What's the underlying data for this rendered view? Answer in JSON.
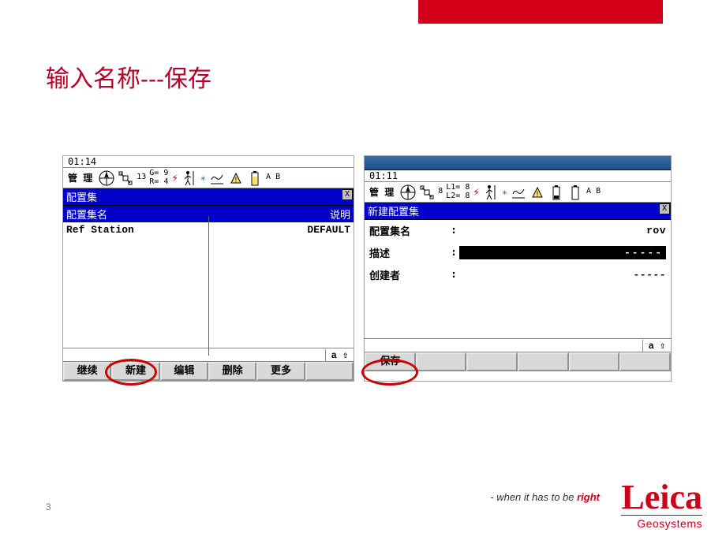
{
  "slide": {
    "title": "输入名称---保存",
    "page": "3",
    "tagline_pre": "- when it has to be ",
    "tagline_em": "right",
    "logo_brand": "Leica",
    "logo_sub": "Geosystems"
  },
  "left": {
    "time": "01:14",
    "mgmt": "管 理",
    "g": "G= 9",
    "r": "R= 4",
    "sat_num": "13",
    "ab": "A  B",
    "section": "配置集",
    "col_name": "配置集名",
    "col_desc": "说明",
    "row_name": "Ref Station",
    "row_desc": "DEFAULT",
    "a_label": "a ⇧",
    "btns": {
      "b1": "继续",
      "b2": "新建",
      "b3": "编辑",
      "b4": "删除",
      "b5": "更多"
    }
  },
  "right": {
    "time": "01:11",
    "mgmt": "管 理",
    "l1": "L1= 8",
    "l2": "L2= 8",
    "sat_num": "8",
    "ab": "A  B",
    "section": "新建配置集",
    "f1_label": "配置集名",
    "f1_value": "rov",
    "f2_label": "描述",
    "f2_value": "-----",
    "f3_label": "创建者",
    "f3_value": "-----",
    "a_label": "a ⇧",
    "btn_save": "保存"
  }
}
